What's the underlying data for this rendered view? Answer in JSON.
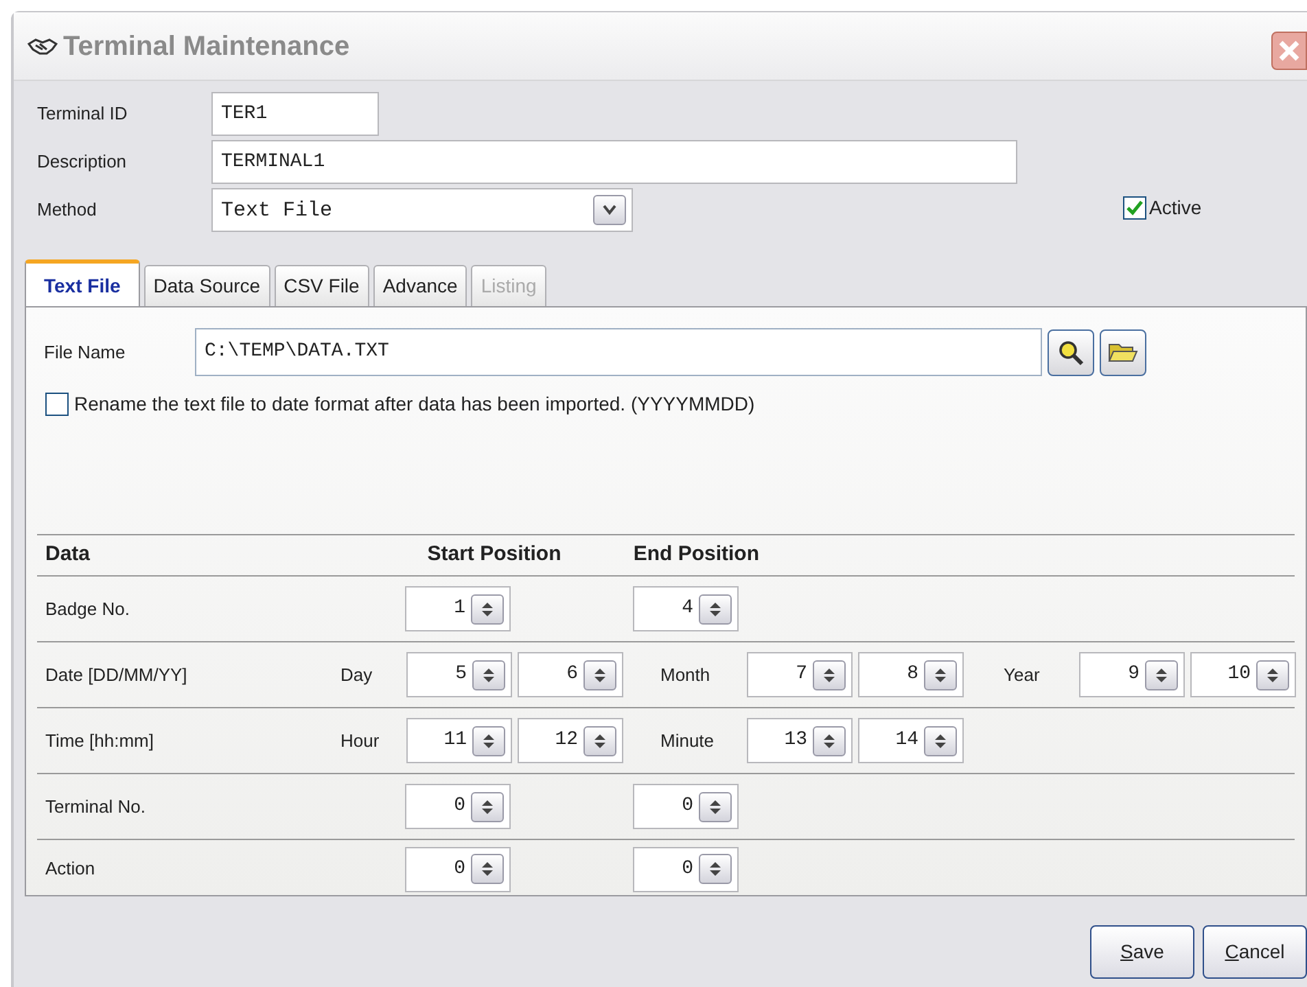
{
  "window": {
    "title": "Terminal Maintenance"
  },
  "fields": {
    "terminal_id": {
      "label": "Terminal ID",
      "value": "TER1"
    },
    "description": {
      "label": "Description",
      "value": "TERMINAL1"
    },
    "method": {
      "label": "Method",
      "value": "Text File"
    }
  },
  "active": {
    "label": "Active",
    "checked": true
  },
  "tabs": [
    {
      "label": "Text File",
      "selected": true,
      "disabled": false
    },
    {
      "label": "Data Source",
      "selected": false,
      "disabled": false
    },
    {
      "label": "CSV File",
      "selected": false,
      "disabled": false
    },
    {
      "label": "Advance",
      "selected": false,
      "disabled": false
    },
    {
      "label": "Listing",
      "selected": false,
      "disabled": true
    }
  ],
  "file_name": {
    "label": "File Name",
    "value": "C:\\TEMP\\DATA.TXT"
  },
  "rename": {
    "label": "Rename the text file to date format after data has been imported. (YYYYMMDD)",
    "checked": false
  },
  "table": {
    "columns": [
      "Data",
      "Start Position",
      "End Position"
    ],
    "rows": [
      {
        "kind": "pair",
        "label": "Badge No.",
        "start": "1",
        "end": "4"
      },
      {
        "kind": "split",
        "label": "Date [DD/MM/YY]",
        "segments": [
          {
            "label": "Day",
            "values": [
              "5",
              "6"
            ]
          },
          {
            "label": "Month",
            "values": [
              "7",
              "8"
            ]
          },
          {
            "label": "Year",
            "values": [
              "9",
              "10"
            ]
          }
        ]
      },
      {
        "kind": "split",
        "label": "Time [hh:mm]",
        "segments": [
          {
            "label": "Hour",
            "values": [
              "11",
              "12"
            ]
          },
          {
            "label": "Minute",
            "values": [
              "13",
              "14"
            ]
          }
        ]
      },
      {
        "kind": "pair",
        "label": "Terminal No.",
        "start": "0",
        "end": "0"
      },
      {
        "kind": "pair",
        "label": "Action",
        "start": "0",
        "end": "0"
      }
    ]
  },
  "buttons": [
    {
      "label": "Save"
    },
    {
      "label": "Cancel"
    }
  ]
}
